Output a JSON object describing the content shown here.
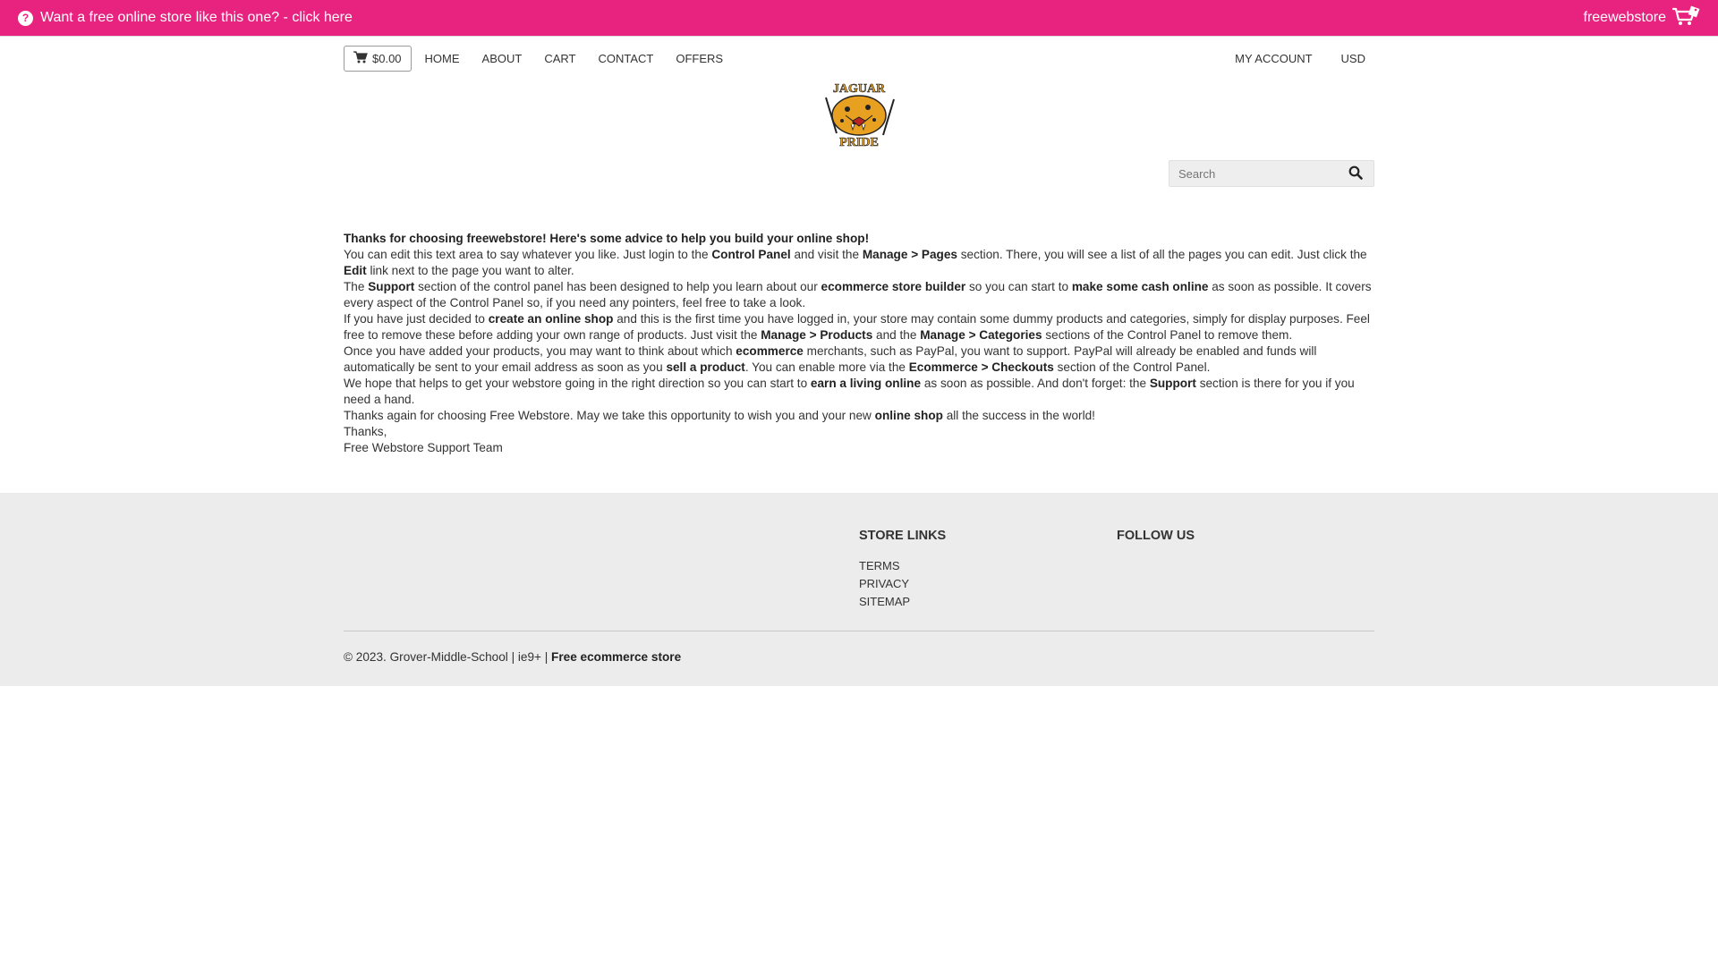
{
  "promo": {
    "text": "Want a free online store like this one? - click here",
    "brand": "freewebstore",
    "color": "#e8237f"
  },
  "nav": {
    "cart_label": "$0.00",
    "items": [
      "HOME",
      "ABOUT",
      "CART",
      "CONTACT",
      "OFFERS"
    ],
    "right_items": [
      "MY ACCOUNT",
      "USD"
    ]
  },
  "logo": {
    "top_text": "JAGUAR",
    "bottom_text": "PRIDE"
  },
  "search": {
    "placeholder": "Search"
  },
  "content": {
    "heading": "Thanks for choosing freewebstore! Here's some advice to help you build your online shop!",
    "p1": [
      "You can edit this text area to say whatever you like. Just login to the ",
      "Control Panel",
      " and visit the ",
      "Manage > Pages",
      " section. There, you will see a list of all the pages you can edit. Just click the ",
      "Edit",
      " link next to the page you want to alter."
    ],
    "p2": [
      "The ",
      "Support",
      " section of the control panel has been designed to help you learn about our ",
      "ecommerce store builder",
      " so you can start to ",
      "make some cash online",
      " as soon as possible. It covers every aspect of the Control Panel so, if you need any pointers, feel free to take a look."
    ],
    "p3": [
      "If you have just decided to ",
      "create an online shop",
      " and this is the first time you have logged in, your store may contain some dummy products and categories, simply for display purposes. Feel free to remove these before adding your own range of products. Just visit the ",
      "Manage > Products",
      " and the ",
      "Manage > Categories",
      " sections of the Control Panel to remove them."
    ],
    "p4": [
      "Once you have added your products, you may want to think about which ",
      "ecommerce",
      " merchants, such as PayPal, you want to support. PayPal will already be enabled and funds will automatically be sent to your email address as soon as you ",
      "sell a product",
      ". You can enable more via the ",
      "Ecommerce > Checkouts",
      " section of the Control Panel."
    ],
    "p5": [
      "We hope that helps to get your webstore going in the right direction so you can start to ",
      "earn a living online",
      " as soon as possible. And don't forget: the ",
      "Support",
      " section is there for you if you need a hand."
    ],
    "p6": [
      "Thanks again for choosing Free Webstore. May we take this opportunity to wish you and your new ",
      "online shop",
      " all the success in the world!"
    ],
    "thanks": "Thanks,",
    "signature": "Free Webstore Support Team"
  },
  "footer": {
    "store_links_heading": "STORE LINKS",
    "store_links": [
      "TERMS",
      "PRIVACY",
      "SITEMAP"
    ],
    "follow_heading": "FOLLOW US",
    "copyright": "© 2023. Grover-Middle-School | ie9+ | ",
    "copyright_link": "Free ecommerce store"
  }
}
